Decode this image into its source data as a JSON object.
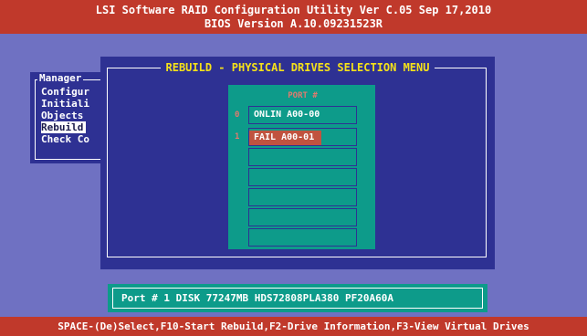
{
  "title": {
    "line1": "LSI Software RAID Configuration Utility Ver C.05 Sep 17,2010",
    "line2": "BIOS Version  A.10.09231523R"
  },
  "left_menu": {
    "title": "Manager",
    "items": [
      "Configur",
      "Initiali",
      "Objects",
      "Rebuild",
      "Check Co"
    ],
    "selected_index": 3
  },
  "rebuild_menu": {
    "title": "REBUILD - PHYSICAL DRIVES SELECTION MENU",
    "port_header": "PORT #",
    "drives": [
      {
        "port": "0",
        "label": "ONLIN A00-00"
      },
      {
        "port": "1",
        "label": "FAIL A00-01",
        "selected": true
      }
    ]
  },
  "info_bar": {
    "text": "Port # 1 DISK  77247MB  HDS72808PLA380  PF20A60A"
  },
  "bottom_bar": {
    "text": "SPACE-(De)Select,F10-Start Rebuild,F2-Drive Information,F3-View Virtual Drives"
  },
  "colors": {
    "background": "#6f71c2",
    "title_bar": "#c0392b",
    "panel": "#2e3193",
    "teal": "#0d9b8a",
    "menu_title": "#f5e11a",
    "fail_highlight": "#c0533f"
  }
}
